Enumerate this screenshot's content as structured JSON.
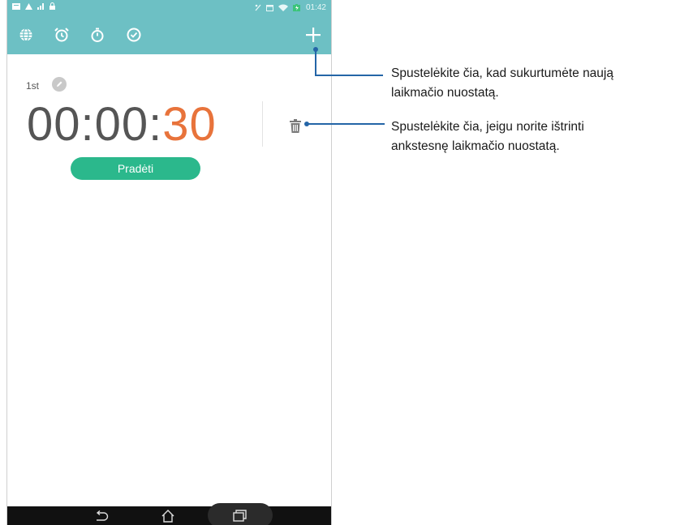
{
  "status_bar": {
    "time": "01:42",
    "icons": [
      "notification-icon",
      "warning-icon",
      "signal-icon",
      "lock-icon",
      "nfc-icon",
      "calendar-icon",
      "wifi-icon",
      "battery-icon"
    ]
  },
  "toolbar": {
    "tabs": [
      {
        "name": "world-clock-tab",
        "icon": "globe-icon"
      },
      {
        "name": "alarm-tab",
        "icon": "alarm-clock-icon"
      },
      {
        "name": "stopwatch-tab",
        "icon": "stopwatch-icon"
      },
      {
        "name": "timer-tab",
        "icon": "timer-icon"
      }
    ],
    "add_icon": "plus-icon",
    "color": "#6dc0c4"
  },
  "timer": {
    "label": "1st",
    "hours_minutes": "00:00:",
    "seconds": "30",
    "seconds_color": "#e8733b",
    "start_label": "Pradėti",
    "start_color": "#2bb88c"
  },
  "annotations": {
    "add_line1": "Spustelėkite čia, kad sukurtumėte naują",
    "add_line2": "laikmačio nuostatą.",
    "delete_line1": "Spustelėkite čia, jeigu norite ištrinti",
    "delete_line2": "ankstesnę laikmačio nuostatą.",
    "line_color": "#2465a7"
  },
  "nav_bar": {
    "buttons": [
      "back-icon",
      "home-icon",
      "recent-apps-icon"
    ]
  }
}
